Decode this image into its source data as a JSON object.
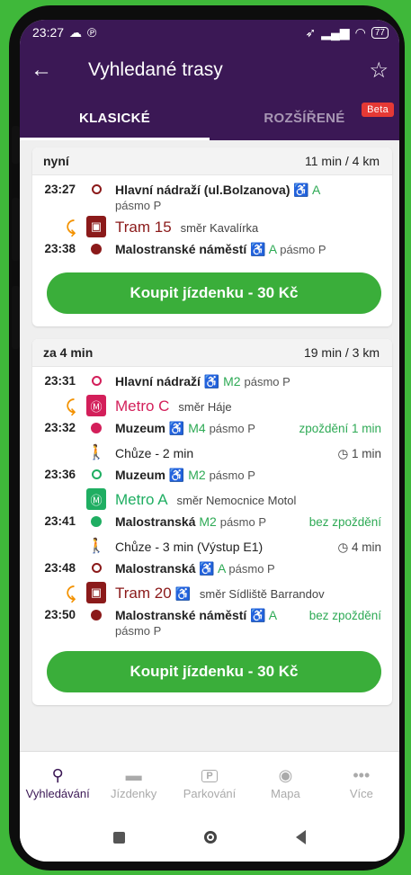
{
  "status": {
    "time": "23:27",
    "battery": "77"
  },
  "appbar": {
    "title": "Vyhledané trasy"
  },
  "tabs": {
    "classic": "KLASICKÉ",
    "extended": "ROZŠÍŘENÉ",
    "beta": "Beta"
  },
  "colors": {
    "purple": "#3b1855",
    "tram": "#8b1a1a",
    "metro_c": "#d31f5a",
    "metro_a": "#1fae62",
    "green": "#2eaa55",
    "walk_accent": "#f39200",
    "button": "#3aae3a"
  },
  "routes": [
    {
      "when": "nyní",
      "summary": "11 min / 4 km",
      "buy_label": "Koupit jízdenku - 30 Kč",
      "legs": {
        "a_time": "23:27",
        "a_stop": "Hlavní nádraží (ul.Bolzanova)",
        "a_line": "A",
        "a_zone": "pásmo P",
        "vehicle": "Tram 15",
        "direction": "směr Kavalírka",
        "b_time": "23:38",
        "b_stop": "Malostranské náměstí",
        "b_line": "A",
        "b_zone": "pásmo P"
      }
    },
    {
      "when": "za 4 min",
      "summary": "19 min / 3 km",
      "buy_label": "Koupit jízdenku - 30 Kč",
      "legs": {
        "l1_time": "23:31",
        "l1_stop": "Hlavní nádraží",
        "l1_line": "M2",
        "l1_zone": "pásmo P",
        "l1_vehicle": "Metro C",
        "l1_direction": "směr Háje",
        "l2_time": "23:32",
        "l2_stop": "Muzeum",
        "l2_line": "M4",
        "l2_zone": "pásmo P",
        "l2_delay": "zpoždění 1 min",
        "walk1": "Chůze - 2 min",
        "walk1_dur": "1 min",
        "l3_time": "23:36",
        "l3_stop": "Muzeum",
        "l3_line": "M2",
        "l3_zone": "pásmo P",
        "l3_vehicle": "Metro A",
        "l3_direction": "směr Nemocnice Motol",
        "l4_time": "23:41",
        "l4_stop": "Malostranská",
        "l4_line": "M2",
        "l4_zone": "pásmo P",
        "l4_delay": "bez zpoždění",
        "walk2": "Chůze - 3 min  (Výstup E1)",
        "walk2_dur": "4 min",
        "l5_time": "23:48",
        "l5_stop": "Malostranská",
        "l5_line": "A",
        "l5_zone": "pásmo P",
        "l5_vehicle": "Tram 20",
        "l5_direction": "směr Sídliště Barrandov",
        "l6_time": "23:50",
        "l6_stop": "Malostranské náměstí",
        "l6_line": "A",
        "l6_zone": "pásmo P",
        "l6_delay": "bez zpoždění"
      }
    }
  ],
  "bottom_nav": [
    {
      "label": "Vyhledávání"
    },
    {
      "label": "Jízdenky"
    },
    {
      "label": "Parkování"
    },
    {
      "label": "Mapa"
    },
    {
      "label": "Více"
    }
  ],
  "parking_letter": "P"
}
